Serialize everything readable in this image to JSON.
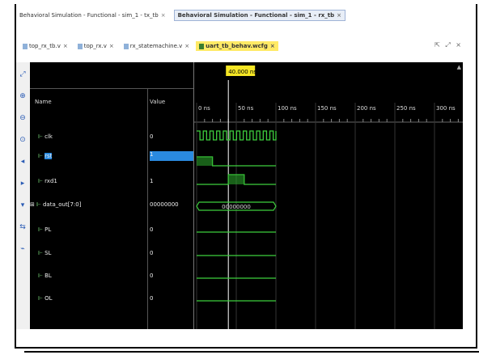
{
  "window_tabs": [
    {
      "label": "Behavioral Simulation - Functional - sim_1 - tx_tb",
      "active": false
    },
    {
      "label": "Behavioral Simulation - Functional - sim_1 - rx_tb",
      "active": true
    }
  ],
  "editor_tabs": [
    {
      "label": "top_rx_tb.v",
      "active": false
    },
    {
      "label": "top_rx.v",
      "active": false
    },
    {
      "label": "rx_statemachine.v",
      "active": false
    },
    {
      "label": "uart_tb_behav.wcfg",
      "active": true
    }
  ],
  "close_glyph": "×",
  "tab_tools": "⇱ ⤢ ×",
  "columns": {
    "name": "Name",
    "value": "Value"
  },
  "cursor_label": "40.000 ns",
  "time_ticks": [
    "0 ns",
    "50 ns",
    "100 ns",
    "150 ns",
    "200 ns",
    "250 ns",
    "300 ns"
  ],
  "signals": [
    {
      "name": "clk",
      "value": "0",
      "kind": "clock"
    },
    {
      "name": "rst",
      "value": "1",
      "kind": "bit",
      "selected": true
    },
    {
      "name": "rxd1",
      "value": "1",
      "kind": "bit"
    },
    {
      "name": "data_out[7:0]",
      "value": "00000000",
      "kind": "bus",
      "bus_label": "00000000"
    },
    {
      "name": "PL",
      "value": "0",
      "kind": "bit"
    },
    {
      "name": "SL",
      "value": "0",
      "kind": "bit"
    },
    {
      "name": "BL",
      "value": "0",
      "kind": "bit"
    },
    {
      "name": "OL",
      "value": "0",
      "kind": "bit"
    }
  ],
  "colors": {
    "wave": "#3ecf3e",
    "cursor": "#f5e625",
    "background": "#000000",
    "selection": "#2a8ae0"
  },
  "toolbar_icons": [
    "zoom-fit-icon",
    "zoom-in-icon",
    "zoom-out-icon",
    "go-to-time-icon",
    "previous-transition-icon",
    "next-transition-icon",
    "add-marker-icon",
    "swap-cursor-icon",
    "snap-icon"
  ]
}
